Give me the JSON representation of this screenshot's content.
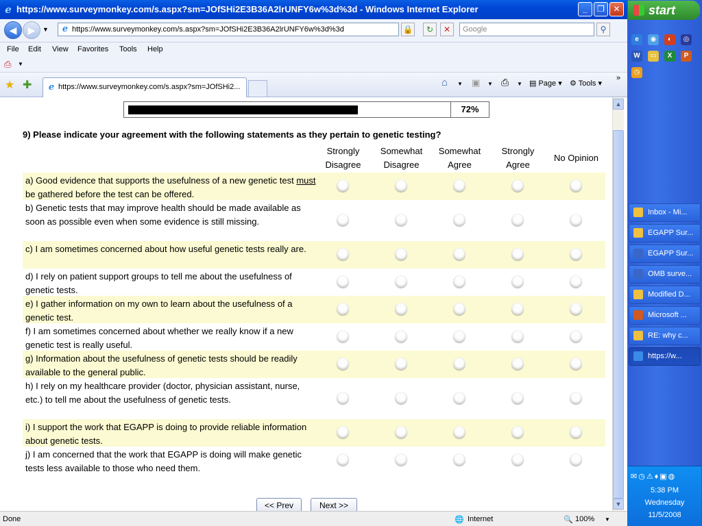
{
  "window": {
    "title": "https://www.surveymonkey.com/s.aspx?sm=JOfSHi2E3B36A2lrUNFY6w%3d%3d - Windows Internet Explorer"
  },
  "address": {
    "url": "https://www.surveymonkey.com/s.aspx?sm=JOfSHi2E3B36A2lrUNFY6w%3d%3d",
    "search_placeholder": "Google"
  },
  "menu": [
    "File",
    "Edit",
    "View",
    "Favorites",
    "Tools",
    "Help"
  ],
  "tab": {
    "title": "https://www.surveymonkey.com/s.aspx?sm=JOfSHi2..."
  },
  "toolbar": {
    "page_label": "Page",
    "tools_label": "Tools"
  },
  "survey": {
    "progress_label": "72%",
    "progress_value": 0.62,
    "question": "9) Please indicate your agreement with the following statements as they pertain to genetic testing?",
    "columns": [
      "Strongly Disagree",
      "Somewhat Disagree",
      "Somewhat Agree",
      "Strongly Agree",
      "No Opinion"
    ],
    "statements": [
      "a) Good evidence that supports the usefulness of a new genetic test must be gathered before the test can be offered.",
      "b) Genetic tests that may improve health should be made available as soon as possible even when some evidence is still missing.",
      "c) I am sometimes concerned about how useful genetic tests really are.",
      "d) I rely on patient support groups to tell me about the usefulness of genetic tests.",
      "e) I gather information on my own to learn about the usefulness of a genetic test.",
      "f) I am sometimes concerned about whether we really know if a new genetic test is really useful.",
      "g) Information about the usefulness of genetic tests should be readily available to the general public.",
      "h) I rely on my healthcare provider (doctor, physician assistant, nurse, etc.) to tell me about the usefulness of genetic tests.",
      "i) I support the work that EGAPP is doing to provide reliable information about genetic tests.",
      "j) I am concerned that the work that EGAPP is doing will make genetic tests less available to those who need them."
    ],
    "prev_label": "<< Prev",
    "next_label": "Next >>"
  },
  "status": {
    "left": "Done",
    "zone": "Internet",
    "zoom": "100%"
  },
  "taskbar": {
    "start_label": "start",
    "items": [
      "Inbox - Mi...",
      "EGAPP Sur...",
      "EGAPP Sur...",
      "OMB surve...",
      "Modified D...",
      "Microsoft ...",
      "RE: why c...",
      "https://w..."
    ],
    "time": "5:38 PM",
    "day": "Wednesday",
    "date": "11/5/2008"
  },
  "colors": {
    "shade": "#fbfad2",
    "title_bar": "#0046d5",
    "taskbar": "#3a70e6"
  }
}
